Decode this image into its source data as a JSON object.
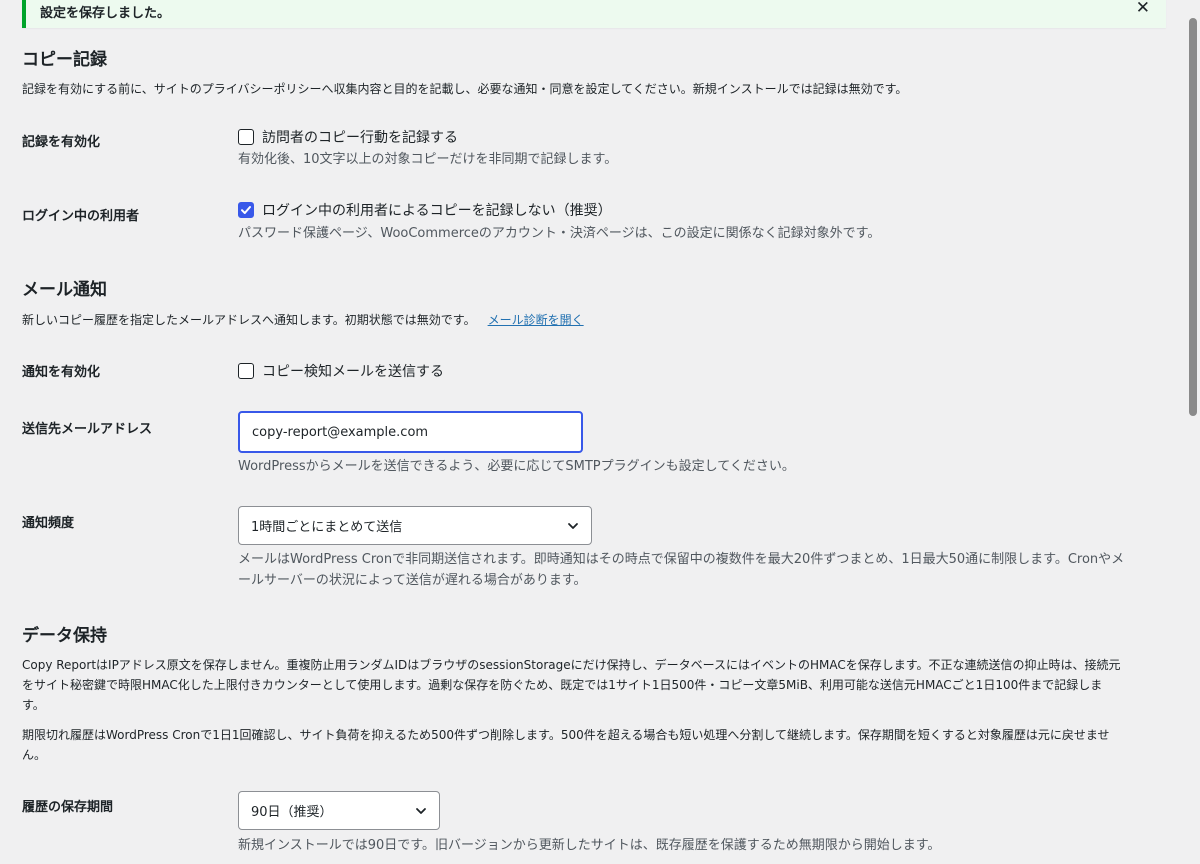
{
  "notice": {
    "text": "設定を保存しました。",
    "close": "✕"
  },
  "copy_record": {
    "title": "コピー記録",
    "description": "記録を有効にする前に、サイトのプライバシーポリシーへ収集内容と目的を記載し、必要な通知・同意を設定してください。新規インストールでは記録は無効です。",
    "enable": {
      "label": "記録を有効化",
      "checkbox_label": "訪問者のコピー行動を記録する",
      "checked": false,
      "help": "有効化後、10文字以上の対象コピーだけを非同期で記録します。"
    },
    "logged_in": {
      "label": "ログイン中の利用者",
      "checkbox_label": "ログイン中の利用者によるコピーを記録しない（推奨）",
      "checked": true,
      "help": "パスワード保護ページ、WooCommerceのアカウント・決済ページは、この設定に関係なく記録対象外です。"
    }
  },
  "mail": {
    "title": "メール通知",
    "description": "新しいコピー履歴を指定したメールアドレスへ通知します。初期状態では無効です。",
    "diag_link": "メール診断を開く",
    "enable": {
      "label": "通知を有効化",
      "checkbox_label": "コピー検知メールを送信する",
      "checked": false
    },
    "address": {
      "label": "送信先メールアドレス",
      "value": "copy-report@example.com",
      "help": "WordPressからメールを送信できるよう、必要に応じてSMTPプラグインも設定してください。"
    },
    "frequency": {
      "label": "通知頻度",
      "selected": "1時間ごとにまとめて送信",
      "help_line1": "メールはWordPress Cronで非同期送信されます。即時通知はその時点で保留中の複数件を最大20件ずつまとめ、1日最大50通に制限します。Cronやメ",
      "help_line2": "ールサーバーの状況によって送信が遅れる場合があります。"
    }
  },
  "retention": {
    "title": "データ保持",
    "para1_line1": "Copy ReportはIPアドレス原文を保存しません。重複防止用ランダムIDはブラウザのsessionStorageにだけ保持し、データベースにはイベントのHMACを保存します。不正な連続送信の抑止時は、接続元",
    "para1_line2": "をサイト秘密鍵で時限HMAC化した上限付きカウンターとして使用します。過剰な保存を防ぐため、既定では1サイト1日500件・コピー文章5MiB、利用可能な送信元HMACごと1日100件まで記録しま",
    "para1_line3": "す。",
    "para2_line1": "期限切れ履歴はWordPress Cronで1日1回確認し、サイト負荷を抑えるため500件ずつ削除します。500件を超える場合も短い処理へ分割して継続します。保存期間を短くすると対象履歴は元に戻せませ",
    "para2_line2": "ん。",
    "period": {
      "label": "履歴の保存期間",
      "selected": "90日（推奨）",
      "help": "新規インストールでは90日です。旧バージョンから更新したサイトは、既存履歴を保護するため無期限から開始します。"
    }
  },
  "colors": {
    "accent": "#3858e9",
    "success": "#00a32a",
    "link": "#2271b1",
    "background": "#f0f0f1"
  }
}
